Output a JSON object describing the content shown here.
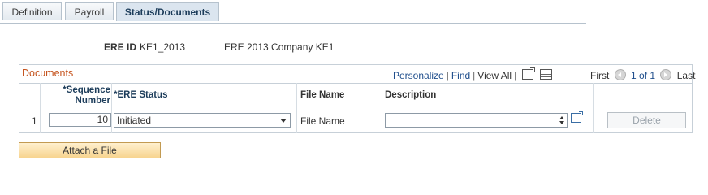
{
  "tabs": [
    {
      "label": "Definition"
    },
    {
      "label": "Payroll"
    },
    {
      "label": "Status/Documents"
    }
  ],
  "header": {
    "ere_id_label": "ERE ID",
    "ere_id_value": "KE1_2013",
    "ere_description": "ERE 2013 Company KE1"
  },
  "grid": {
    "title": "Documents",
    "personalize": "Personalize",
    "find": "Find",
    "view_all": "View All",
    "nav_first": "First",
    "nav_count": "1 of 1",
    "nav_last": "Last",
    "columns": {
      "seq_line1": "*Sequence",
      "seq_line2": "Number",
      "status": "*ERE Status",
      "file_name": "File Name",
      "description": "Description"
    },
    "rows": [
      {
        "row_number": "1",
        "sequence": "10",
        "status": "Initiated",
        "file_name": "File Name",
        "description": "",
        "delete_label": "Delete"
      }
    ]
  },
  "actions": {
    "attach_label": "Attach a File"
  },
  "colors": {
    "grid_title": "#c5531d",
    "link": "#1f4e8c",
    "attach_bg": "#f7d48f"
  }
}
